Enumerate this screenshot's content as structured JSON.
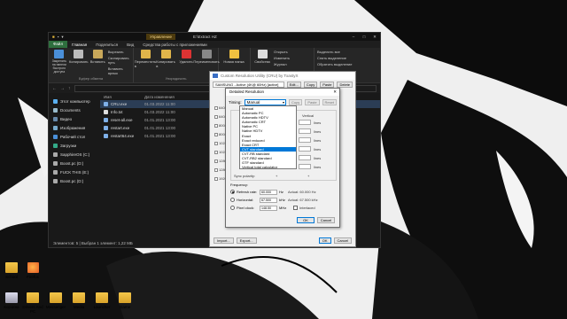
{
  "desktop": {
    "icons": [
      {
        "label": "School"
      },
      {
        "label": "Firefox"
      },
      {
        "label": "Корзина"
      },
      {
        "label": "Drivers And PC"
      },
      {
        "label": "Messenger"
      },
      {
        "label": "Media"
      },
      {
        "label": "Launcher"
      },
      {
        "label": "Game"
      }
    ]
  },
  "explorer": {
    "context_tab": "Управление",
    "title": "E:\\Extract HZ",
    "ribbon_tabs": [
      "Файл",
      "Главная",
      "Поделиться",
      "Вид",
      "Средства работы с приложениями"
    ],
    "ribbon": {
      "clipboard": {
        "pin": "Закрепить на панели быстрого доступа",
        "copy": "Копировать",
        "paste": "Вставить",
        "cut": "Вырезать",
        "copy_path": "Скопировать путь",
        "paste_shortcut": "Вставить ярлык",
        "group": "Буфер обмена"
      },
      "organize": {
        "move_to": "Переместить в",
        "copy_to": "Копировать в",
        "delete": "Удалить",
        "rename": "Переименовать",
        "group": "Упорядочить"
      },
      "new": {
        "new_folder": "Новая папка",
        "group": "Создать"
      },
      "open": {
        "properties": "Свойства",
        "open": "Открыть",
        "edit": "Изменить",
        "journal": "Журнал",
        "group": "Открыть"
      },
      "select": {
        "select_all": "Выделить все",
        "select_none": "Снять выделение",
        "invert": "Обратить выделение",
        "group": "Выделить"
      }
    },
    "nav": [
      "Этот компьютер",
      "Documents",
      "Видео",
      "Изображения",
      "Рабочий стол",
      "Загрузки",
      "SapphireOS (C:)",
      "Boost.pc (D:)",
      "FUCK THIS (E:)",
      "Boost.pc (D:)"
    ],
    "columns": [
      "Имя",
      "Дата изменения"
    ],
    "files": [
      {
        "name": "CRU.exe",
        "date": "01.03.2022 11:00"
      },
      {
        "name": "Info.txt",
        "date": "01.03.2022 11:00"
      },
      {
        "name": "reset-all.exe",
        "date": "01.01.2021 13:00"
      },
      {
        "name": "restart.exe",
        "date": "01.01.2021 13:00"
      },
      {
        "name": "restart64.exe",
        "date": "01.01.2021 13:00"
      }
    ],
    "status": "Элементов: 5  |  Выбран 1 элемент: 1,22 МБ"
  },
  "cru": {
    "title": "Custom Resolution Utility (CRU) by ToastyX",
    "monitor": "SAMSUNG - Active (4K@ 60Hz) [active]",
    "buttons_top": [
      "Edit...",
      "Copy",
      "Paste",
      "Delete"
    ],
    "established": [
      "640x480",
      "640x480",
      "800x600",
      "800x600",
      "1024x768",
      "1024x768",
      "1280x720",
      "1280x720",
      "1920x1080"
    ],
    "import": "Import...",
    "export": "Export...",
    "ok": "OK",
    "cancel": "Cancel"
  },
  "detail": {
    "title": "Detailed Resolution",
    "timing_label": "Timing:",
    "timing_value": "Manual",
    "timing_buttons": [
      "Copy",
      "Paste",
      "Reset"
    ],
    "panel_labels": [
      "Horizontal",
      "Vertical",
      "lines",
      "lines",
      "lines",
      "lines",
      "lines",
      "lines"
    ],
    "sync_label": "Sync polarity:",
    "fixed_label": "Frequency:",
    "freq": [
      {
        "label": "Refresh rate:",
        "value": "60.000",
        "unit": "Hz",
        "actual": "Actual: 60.000 Hz"
      },
      {
        "label": "Horizontal:",
        "value": "67.500",
        "unit": "kHz",
        "actual": "Actual: 67.500 kHz"
      },
      {
        "label": "Pixel clock:",
        "value": "148.50",
        "unit": "MHz",
        "actual": "Interlaced"
      }
    ],
    "ok": "OK",
    "cancel": "Cancel"
  },
  "dropdown": {
    "items": [
      "Manual",
      "Automatic PC",
      "Automatic HDTV",
      "Automatic CRT",
      "Native PC",
      "Native HDTV",
      "Exact",
      "Exact reduced",
      "Exact CRT",
      "CVT standard",
      "CVT-RB standard",
      "CVT-RB2 standard",
      "GTF standard",
      "Vertical total calculator"
    ],
    "highlighted_index": 9
  },
  "colors": {
    "explorer_bg": "#191919",
    "accent": "#0078d7",
    "file_tab": "#2e6f3e"
  }
}
